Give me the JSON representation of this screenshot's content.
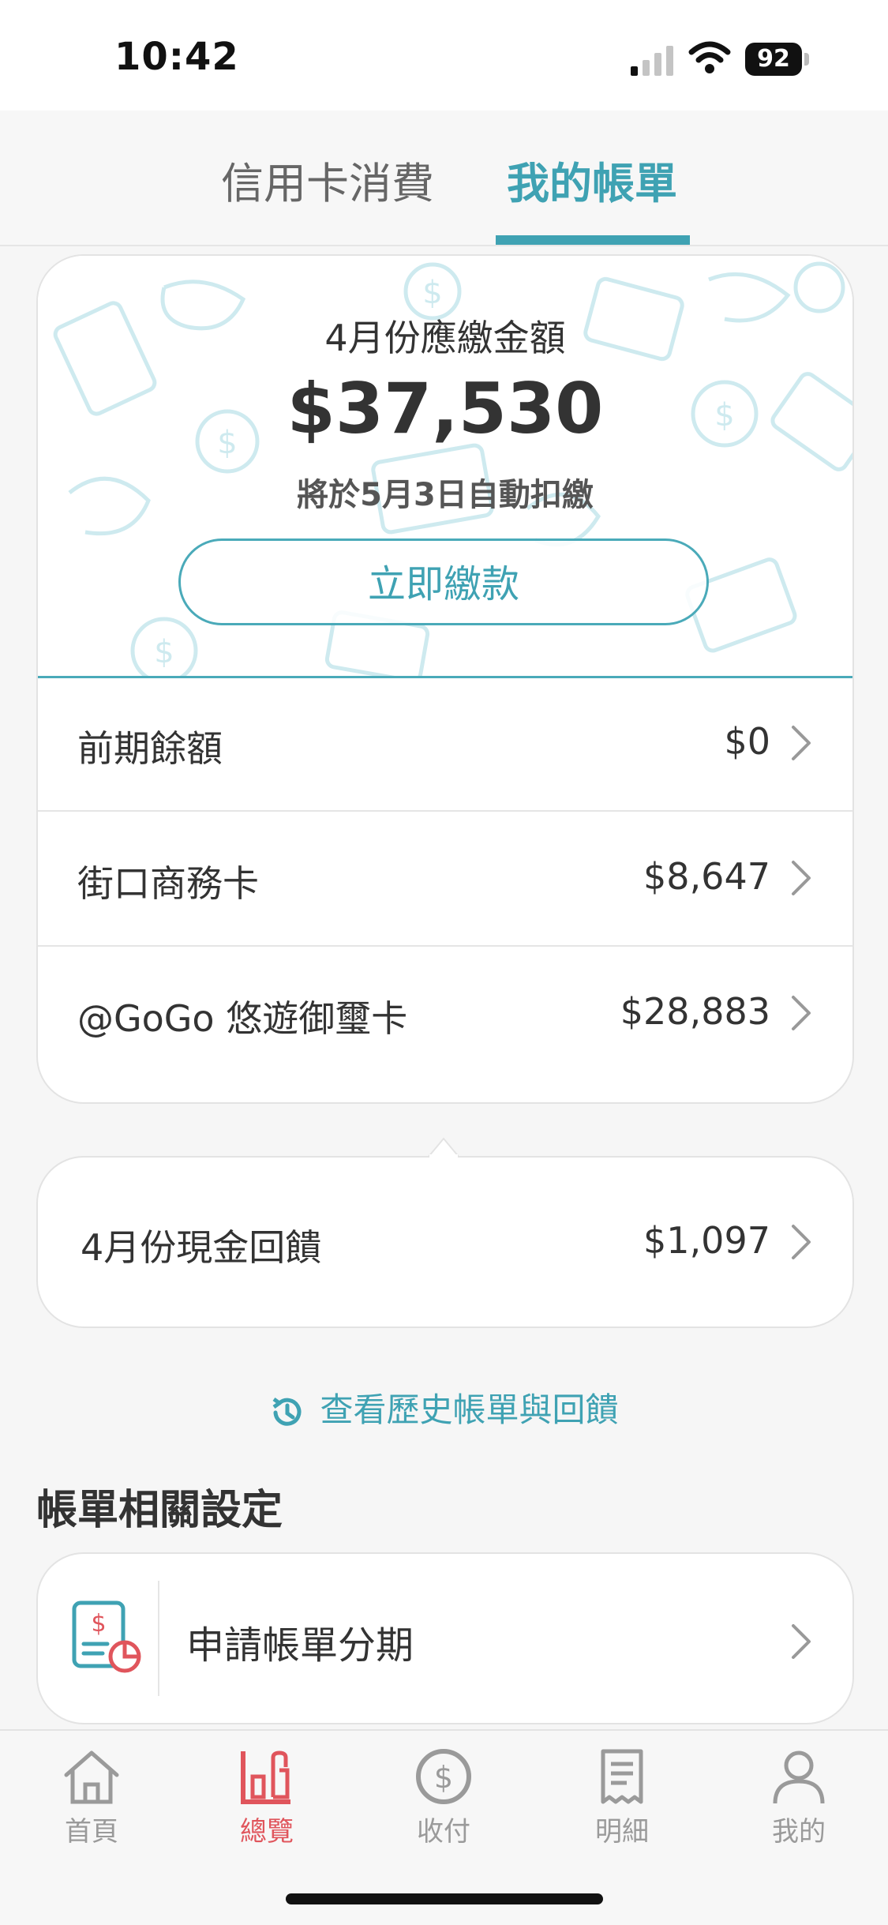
{
  "status_bar": {
    "time": "10:42",
    "battery": "92"
  },
  "tabs": [
    {
      "label": "信用卡消費",
      "active": false
    },
    {
      "label": "我的帳單",
      "active": true
    }
  ],
  "bill": {
    "month_title": "4月份應繳金額",
    "amount": "$37,530",
    "due_note": "將於5月3日自動扣繳",
    "pay_button": "立即繳款",
    "rows": [
      {
        "label": "前期餘額",
        "value": "$0"
      },
      {
        "label": "街口商務卡",
        "value": "$8,647"
      },
      {
        "label": "@GoGo 悠遊御璽卡",
        "value": "$28,883"
      }
    ]
  },
  "cashback": {
    "label": "4月份現金回饋",
    "value": "$1,097"
  },
  "history_link": "查看歷史帳單與回饋",
  "settings": {
    "title": "帳單相關設定",
    "install_label": "申請帳單分期"
  },
  "nav": [
    {
      "label": "首頁",
      "icon": "home-icon",
      "active": false
    },
    {
      "label": "總覽",
      "icon": "overview-chart-icon",
      "active": true
    },
    {
      "label": "收付",
      "icon": "dollar-coin-icon",
      "active": false
    },
    {
      "label": "明細",
      "icon": "receipt-icon",
      "active": false
    },
    {
      "label": "我的",
      "icon": "profile-icon",
      "active": false
    }
  ],
  "colors": {
    "accent": "#3fa2b3",
    "nav_active": "#e0555c",
    "nav_inactive": "#9a9a9a"
  }
}
